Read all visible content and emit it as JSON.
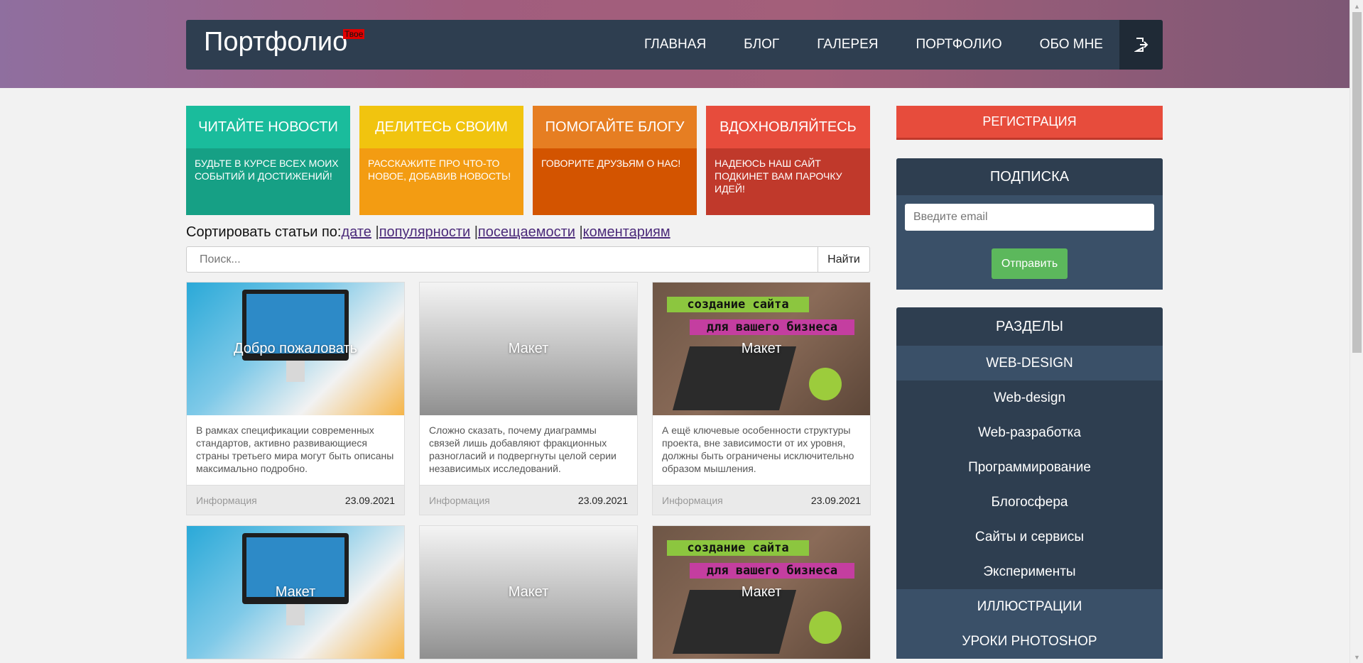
{
  "header": {
    "brand": "Портфолио",
    "brand_badge": "Твое",
    "nav": [
      "ГЛАВНАЯ",
      "БЛОГ",
      "ГАЛЕРЕЯ",
      "ПОРТФОЛИО",
      "ОБО МНЕ"
    ],
    "logout_icon": "logout-icon"
  },
  "tiles": [
    {
      "title": "ЧИТАЙТЕ НОВОСТИ",
      "text": "БУДЬТЕ В КУРСЕ ВСЕХ МОИХ СОБЫТИЙ И ДОСТИЖЕНИЙ!",
      "head_color": "#1abc9c",
      "body_color": "#16a085"
    },
    {
      "title": "ДЕЛИТЕСЬ СВОИМ",
      "text": "РАССКАЖИТЕ ПРО ЧТО-ТО НОВОЕ, ДОБАВИВ НОВОСТЬ!",
      "head_color": "#f1c40f",
      "body_color": "#f39c12"
    },
    {
      "title": "ПОМОГАЙТЕ БЛОГУ",
      "text": "ГОВОРИТЕ ДРУЗЬЯМ О НАС!",
      "head_color": "#e67e22",
      "body_color": "#d35400"
    },
    {
      "title": "ВДОХНОВЛЯЙТЕСЬ",
      "text": "НАДЕЮСЬ НАШ САЙТ ПОДКИНЕТ ВАМ ПАРОЧКУ ИДЕЙ!",
      "head_color": "#e74c3c",
      "body_color": "#c0392b"
    }
  ],
  "sort": {
    "label": "Сортировать статьи по:",
    "options": [
      "дате",
      "популярности",
      "посещаемости",
      "коментариям"
    ],
    "separator": "|"
  },
  "search": {
    "placeholder": "Поиск...",
    "button": "Найти"
  },
  "cards": [
    {
      "image": "desk",
      "title": "Добро пожаловать",
      "text": "В рамках спецификации современных стандартов, активно развивающиеся страны третьего мира могут быть описаны максимально подробно.",
      "category": "Информация",
      "date": "23.09.2021"
    },
    {
      "image": "gray",
      "title": "Макет",
      "text": "Сложно сказать, почему диаграммы связей лишь добавляют фракционных разногласий и подвергнуты целой серии независимых исследований.",
      "category": "Информация",
      "date": "23.09.2021"
    },
    {
      "image": "biz",
      "title": "Макет",
      "text": "А ещё ключевые особенности структуры проекта, вне зависимости от их уровня, должны быть ограничены исключительно образом мышления.",
      "category": "Информация",
      "date": "23.09.2021"
    },
    {
      "image": "desk",
      "title": "Макет",
      "text": "",
      "category": "",
      "date": ""
    },
    {
      "image": "gray",
      "title": "Макет",
      "text": "",
      "category": "",
      "date": ""
    },
    {
      "image": "biz",
      "title": "Макет",
      "text": "",
      "category": "",
      "date": ""
    }
  ],
  "biz_banner": {
    "line1": "создание сайта",
    "line2": "для вашего бизнеса"
  },
  "sidebar": {
    "register": "РЕГИСТРАЦИЯ",
    "subscribe_title": "ПОДПИСКА",
    "email_placeholder": "Введите email",
    "send": "Отправить",
    "sections_title": "РАЗДЕЛЫ",
    "sections": [
      {
        "label": "WEB-DESIGN",
        "type": "head"
      },
      {
        "label": "Web-design",
        "type": "item"
      },
      {
        "label": "Web-разработка",
        "type": "item"
      },
      {
        "label": "Программирование",
        "type": "item"
      },
      {
        "label": "Блогосфера",
        "type": "item"
      },
      {
        "label": "Сайты и сервисы",
        "type": "item"
      },
      {
        "label": "Эксперименты",
        "type": "item"
      },
      {
        "label": "ИЛЛЮСТРАЦИИ",
        "type": "head"
      },
      {
        "label": "УРОКИ PHOTOSHOP",
        "type": "head"
      }
    ]
  }
}
